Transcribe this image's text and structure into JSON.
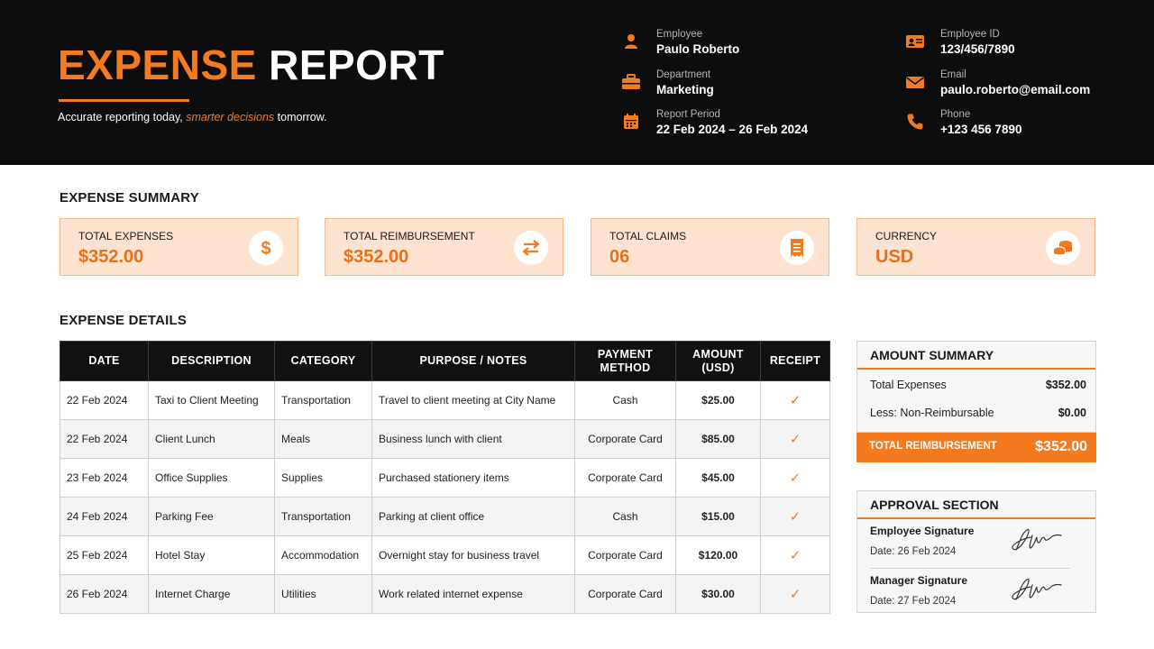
{
  "header": {
    "title_part1": "EXPENSE",
    "title_part2": "REPORT",
    "tagline_pre": "Accurate reporting today, ",
    "tagline_em": "smarter decisions",
    "tagline_post": " tomorrow."
  },
  "info": {
    "employee": {
      "label": "Employee",
      "value": "Paulo Roberto",
      "icon": "person-icon"
    },
    "department": {
      "label": "Department",
      "value": "Marketing",
      "icon": "briefcase-icon"
    },
    "period": {
      "label": "Report Period",
      "value": "22 Feb 2024 – 26 Feb 2024",
      "icon": "calendar-icon"
    },
    "employee_id": {
      "label": "Employee ID",
      "value": "123/456/7890",
      "icon": "id-card-icon"
    },
    "email": {
      "label": "Email",
      "value": "paulo.roberto@email.com",
      "icon": "envelope-icon"
    },
    "phone": {
      "label": "Phone",
      "value": "+123 456 7890",
      "icon": "phone-icon"
    }
  },
  "summary": {
    "title": "EXPENSE SUMMARY",
    "cards": [
      {
        "label": "TOTAL EXPENSES",
        "value": "$352.00",
        "icon": "dollar-icon"
      },
      {
        "label": "TOTAL REIMBURSEMENT",
        "value": "$352.00",
        "icon": "exchange-arrows-icon"
      },
      {
        "label": "TOTAL CLAIMS",
        "value": "06",
        "icon": "receipt-icon"
      },
      {
        "label": "CURRENCY",
        "value": "USD",
        "icon": "coins-icon"
      }
    ]
  },
  "details": {
    "title": "EXPENSE DETAILS",
    "headers": [
      "DATE",
      "DESCRIPTION",
      "CATEGORY",
      "PURPOSE / NOTES",
      "PAYMENT METHOD",
      "AMOUNT (USD)",
      "RECEIPT"
    ],
    "rows": [
      {
        "date": "22 Feb 2024",
        "description": "Taxi to Client Meeting",
        "category": "Transportation",
        "notes": "Travel to client meeting at City Name",
        "method": "Cash",
        "amount": "$25.00",
        "receipt": "✓"
      },
      {
        "date": "22 Feb 2024",
        "description": "Client Lunch",
        "category": "Meals",
        "notes": "Business lunch with client",
        "method": "Corporate Card",
        "amount": "$85.00",
        "receipt": "✓"
      },
      {
        "date": "23 Feb 2024",
        "description": "Office Supplies",
        "category": "Supplies",
        "notes": "Purchased stationery items",
        "method": "Corporate Card",
        "amount": "$45.00",
        "receipt": "✓"
      },
      {
        "date": "24 Feb 2024",
        "description": "Parking Fee",
        "category": "Transportation",
        "notes": "Parking at client office",
        "method": "Cash",
        "amount": "$15.00",
        "receipt": "✓"
      },
      {
        "date": "25 Feb 2024",
        "description": "Hotel Stay",
        "category": "Accommodation",
        "notes": "Overnight stay for business travel",
        "method": "Corporate Card",
        "amount": "$120.00",
        "receipt": "✓"
      },
      {
        "date": "26 Feb 2024",
        "description": "Internet Charge",
        "category": "Utilities",
        "notes": "Work related internet expense",
        "method": "Corporate Card",
        "amount": "$30.00",
        "receipt": "✓"
      }
    ]
  },
  "amount_summary": {
    "title": "AMOUNT SUMMARY",
    "total_expenses_label": "Total Expenses",
    "total_expenses_value": "$352.00",
    "non_reimb_label": "Less: Non-Reimbursable",
    "non_reimb_value": "$0.00",
    "total_reimb_label": "TOTAL REIMBURSEMENT",
    "total_reimb_value": "$352.00"
  },
  "approval": {
    "title": "APPROVAL SECTION",
    "employee_label": "Employee Signature",
    "employee_date": "Date: 26 Feb 2024",
    "manager_label": "Manager Signature",
    "manager_date": "Date: 27 Feb 2024"
  },
  "colors": {
    "accent": "#f47a20",
    "header_bg": "#0d0d0d",
    "card_bg": "#fde3d0"
  }
}
